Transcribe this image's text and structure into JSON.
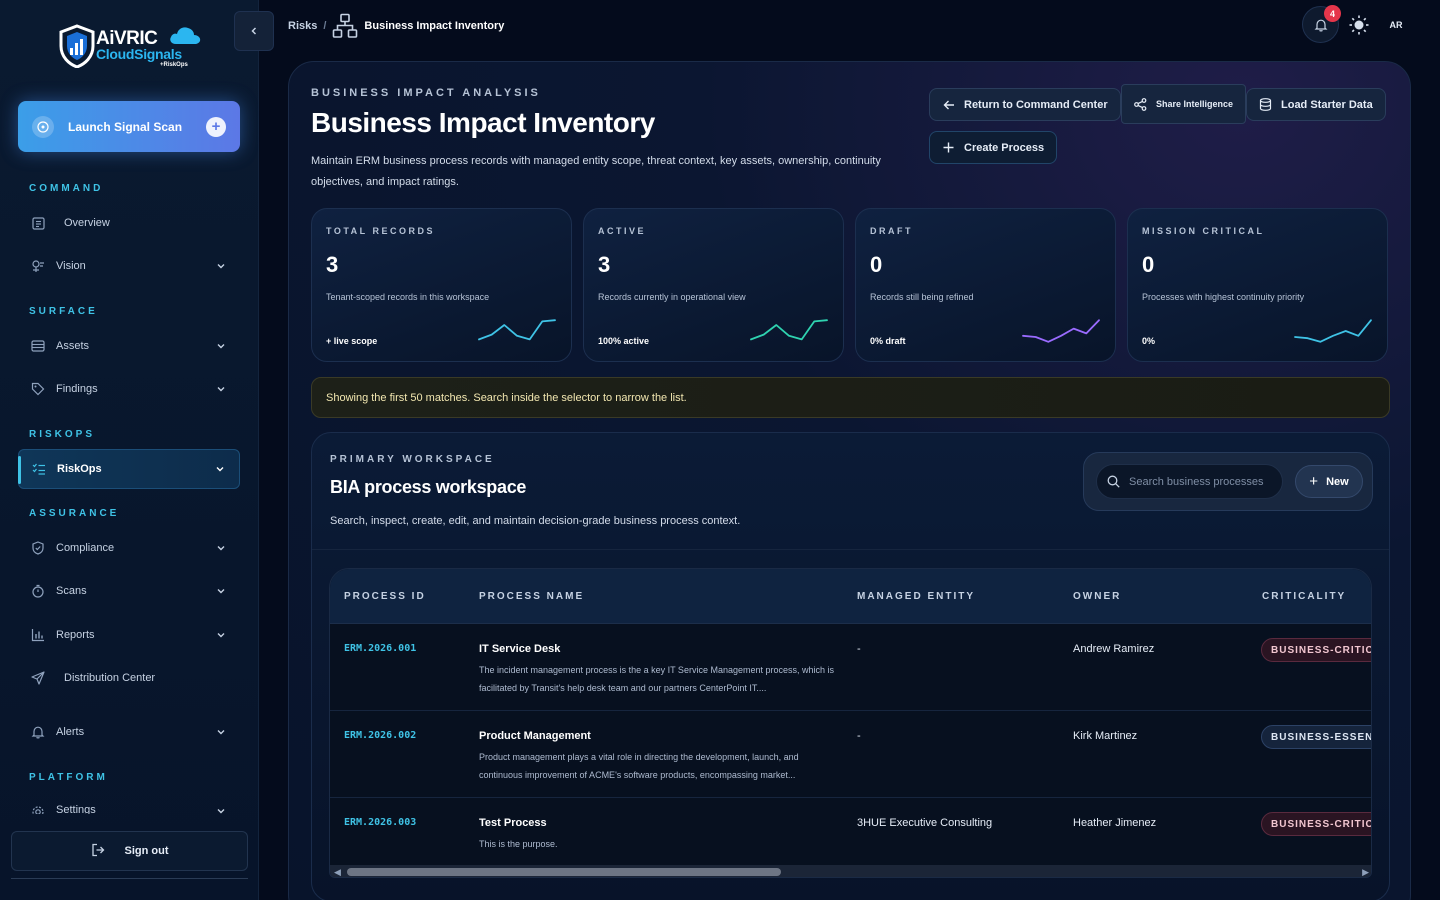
{
  "brand": {
    "line1": "AiVRIC",
    "line2": "CloudSignals",
    "line3": "+RiskOps"
  },
  "colors": {
    "accent": "#3fc3e6",
    "primary_button": "#5c78e6",
    "critical": "#e5364b",
    "spark_teal": "#3fc3e6",
    "spark_purple": "#9a6bff"
  },
  "sidebar": {
    "launch_label": "Launch Signal Scan",
    "sections": [
      {
        "title": "COMMAND"
      },
      {
        "title": "SURFACE"
      },
      {
        "title": "RISKOPS"
      },
      {
        "title": "ASSURANCE"
      },
      {
        "title": "PLATFORM"
      }
    ],
    "items": [
      {
        "label": "Overview",
        "icon": "overview-icon"
      },
      {
        "label": "Vision",
        "icon": "vision-icon"
      },
      {
        "label": "Assets",
        "icon": "assets-icon"
      },
      {
        "label": "Findings",
        "icon": "tag-icon"
      },
      {
        "label": "RiskOps",
        "icon": "list-icon"
      },
      {
        "label": "Compliance",
        "icon": "shield-icon"
      },
      {
        "label": "Scans",
        "icon": "timer-icon"
      },
      {
        "label": "Reports",
        "icon": "bar-chart-icon"
      },
      {
        "label": "Distribution Center",
        "icon": "send-icon"
      },
      {
        "label": "Alerts",
        "icon": "bell-icon"
      },
      {
        "label": "Settings",
        "icon": "gear-icon"
      }
    ],
    "signout_label": "Sign out"
  },
  "topbar": {
    "breadcrumb_root": "Risks",
    "breadcrumb_sep": "/",
    "breadcrumb_current": "Business Impact Inventory",
    "notifications_count": "4",
    "avatar_initials": "AR"
  },
  "header": {
    "eyebrow": "BUSINESS IMPACT ANALYSIS",
    "title": "Business Impact Inventory",
    "description": "Maintain ERM business process records with managed entity scope, threat context, key assets, ownership, continuity objectives, and impact ratings.",
    "buttons": {
      "return": "Return to Command Center",
      "share": "Share Intelligence",
      "load": "Load Starter Data",
      "create": "Create Process"
    }
  },
  "stats": [
    {
      "label": "TOTAL RECORDS",
      "value": "3",
      "description": "Tenant-scoped records in this workspace",
      "footer": "+ live scope",
      "spark": [
        0.15,
        0.35,
        0.75,
        0.3,
        0.15,
        0.9,
        0.95
      ]
    },
    {
      "label": "ACTIVE",
      "value": "3",
      "description": "Records currently in operational view",
      "footer": "100% active",
      "spark": [
        0.15,
        0.35,
        0.75,
        0.3,
        0.15,
        0.9,
        0.95
      ]
    },
    {
      "label": "DRAFT",
      "value": "0",
      "description": "Records still being refined",
      "footer": "0% draft",
      "spark": [
        0.3,
        0.25,
        0.05,
        0.3,
        0.6,
        0.4,
        0.95
      ]
    },
    {
      "label": "MISSION CRITICAL",
      "value": "0",
      "description": "Processes with highest continuity priority",
      "footer": "0%",
      "spark": [
        0.25,
        0.2,
        0.05,
        0.3,
        0.5,
        0.3,
        0.95
      ]
    }
  ],
  "notice": "Showing the first 50 matches. Search inside the selector to narrow the list.",
  "workspace": {
    "eyebrow": "PRIMARY WORKSPACE",
    "title": "BIA process workspace",
    "description": "Search, inspect, create, edit, and maintain decision-grade business process context.",
    "search_placeholder": "Search business processes",
    "new_label": "New"
  },
  "table": {
    "columns": [
      "PROCESS ID",
      "PROCESS NAME",
      "MANAGED ENTITY",
      "OWNER",
      "CRITICALITY"
    ],
    "rows": [
      {
        "id": "ERM.2026.001",
        "name": "IT Service Desk",
        "description": "The incident management process is the a key IT Service Management process, which is facilitated by Transit's help desk team and our partners CenterPoint IT....",
        "entity": "-",
        "owner": "Andrew Ramirez",
        "criticality": "BUSINESS-CRITICAL"
      },
      {
        "id": "ERM.2026.002",
        "name": "Product Management",
        "description": "Product management plays a vital role in directing the development, launch, and continuous improvement of ACME's software products, encompassing market...",
        "entity": "-",
        "owner": "Kirk Martinez",
        "criticality": "BUSINESS-ESSENTIAL"
      },
      {
        "id": "ERM.2026.003",
        "name": "Test Process",
        "description": "This is the purpose.",
        "entity": "3HUE Executive Consulting",
        "owner": "Heather Jimenez",
        "criticality": "BUSINESS-CRITICAL"
      }
    ],
    "scroll_fraction": 0.43
  }
}
